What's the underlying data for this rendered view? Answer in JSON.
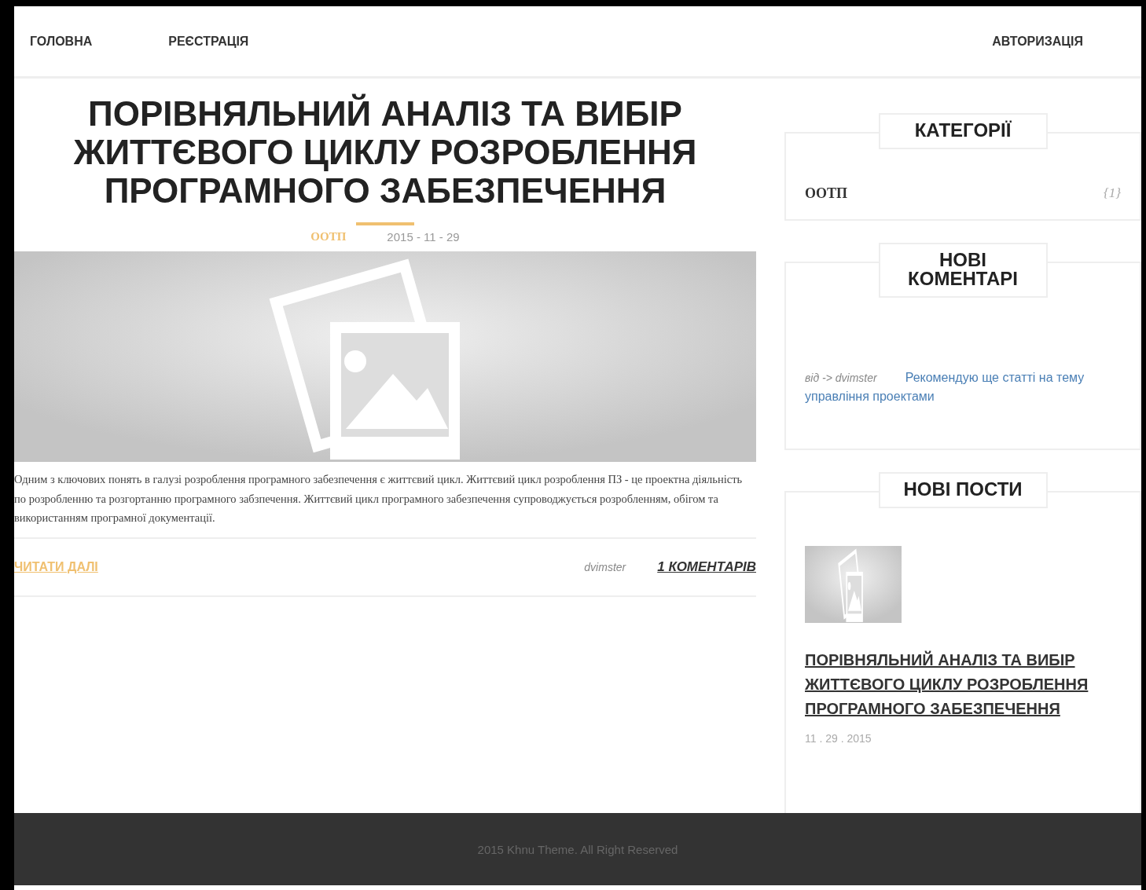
{
  "nav": {
    "left": [
      {
        "label": "ГОЛОВНА"
      },
      {
        "label": "РЕЄСТРАЦІЯ"
      }
    ],
    "right": [
      {
        "label": "АВТОРИЗАЦІЯ"
      }
    ]
  },
  "post": {
    "title": "ПОРІВНЯЛЬНИЙ АНАЛІЗ ТА ВИБІР ЖИТТЄВОГО ЦИКЛУ РОЗРОБЛЕННЯ ПРОГРАМНОГО ЗАБЕЗПЕЧЕННЯ",
    "category": "ООТП",
    "date": "2015 - 11 - 29",
    "excerpt": "Одним з ключових понять в галузі розроблення програмного забезпечення є життєвий цикл. Життєвий цикл розроблення ПЗ - це проектна діяльність по розробленню та розгортанню програмного забзпечення. Життєвий цикл програмного забезпечення супроводжується розробленням, обігом та використанням програмної документації.",
    "read_more": "ЧИТАТИ ДАЛІ",
    "author": "dvimster",
    "comments": "1 КОМЕНТАРІВ"
  },
  "sidebar": {
    "categories": {
      "title": "КАТЕГОРІЇ",
      "items": [
        {
          "name": "ООТП",
          "count": "{1}"
        }
      ]
    },
    "comments": {
      "title": "НОВІ КОМЕНТАРІ",
      "items": [
        {
          "author": "від -> dvimster",
          "text": "Рекомендую ще статті на тему управління проектами"
        }
      ]
    },
    "posts": {
      "title": "НОВІ ПОСТИ",
      "items": [
        {
          "title": "ПОРІВНЯЛЬНИЙ АНАЛІЗ ТА ВИБІР ЖИТТЄВОГО ЦИКЛУ РОЗРОБЛЕННЯ ПРОГРАМНОГО ЗАБЕЗПЕЧЕННЯ",
          "date": "11 . 29 . 2015"
        }
      ]
    }
  },
  "footer": {
    "text": "2015 Khnu Theme. All Right Reserved"
  }
}
